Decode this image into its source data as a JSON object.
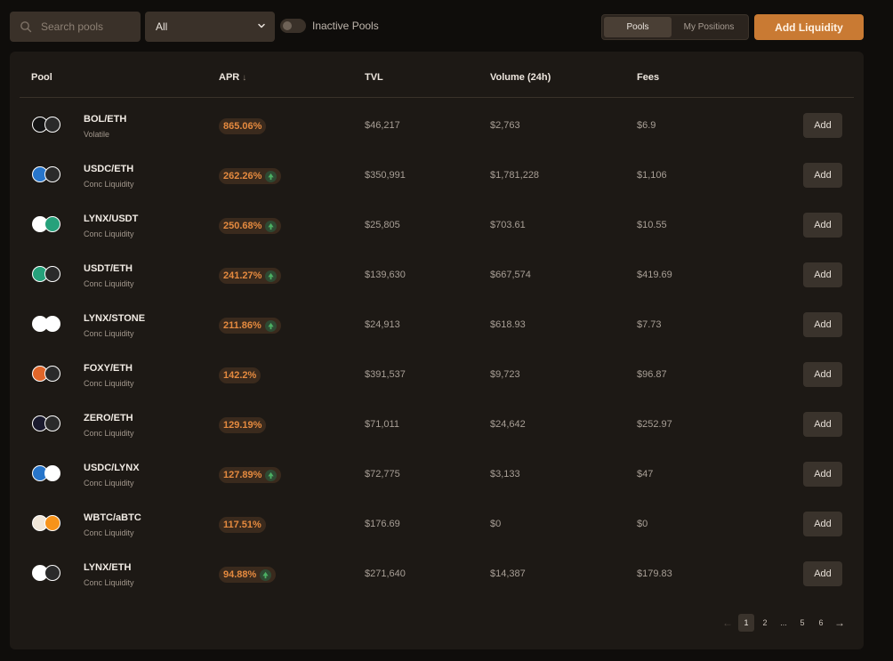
{
  "search": {
    "placeholder": "Search pools"
  },
  "filter": {
    "selected": "All"
  },
  "inactive_toggle": {
    "label": "Inactive Pools"
  },
  "view_tabs": [
    {
      "label": "Pools"
    },
    {
      "label": "My Positions"
    }
  ],
  "add_liquidity": {
    "label": "Add Liquidity"
  },
  "columns": {
    "pool": "Pool",
    "apr": "APR",
    "tvl": "TVL",
    "volume": "Volume (24h)",
    "fees": "Fees"
  },
  "rows": [
    {
      "pair": "BOL/ETH",
      "type": "Volatile",
      "apr": "865.06%",
      "boost": false,
      "tvl": "$46,217",
      "volume": "$2,763",
      "fees": "$6.9",
      "add": "Add"
    },
    {
      "pair": "USDC/ETH",
      "type": "Conc Liquidity",
      "apr": "262.26%",
      "boost": true,
      "tvl": "$350,991",
      "volume": "$1,781,228",
      "fees": "$1,106",
      "add": "Add"
    },
    {
      "pair": "LYNX/USDT",
      "type": "Conc Liquidity",
      "apr": "250.68%",
      "boost": true,
      "tvl": "$25,805",
      "volume": "$703.61",
      "fees": "$10.55",
      "add": "Add"
    },
    {
      "pair": "USDT/ETH",
      "type": "Conc Liquidity",
      "apr": "241.27%",
      "boost": true,
      "tvl": "$139,630",
      "volume": "$667,574",
      "fees": "$419.69",
      "add": "Add"
    },
    {
      "pair": "LYNX/STONE",
      "type": "Conc Liquidity",
      "apr": "211.86%",
      "boost": true,
      "tvl": "$24,913",
      "volume": "$618.93",
      "fees": "$7.73",
      "add": "Add"
    },
    {
      "pair": "FOXY/ETH",
      "type": "Conc Liquidity",
      "apr": "142.2%",
      "boost": false,
      "tvl": "$391,537",
      "volume": "$9,723",
      "fees": "$96.87",
      "add": "Add"
    },
    {
      "pair": "ZERO/ETH",
      "type": "Conc Liquidity",
      "apr": "129.19%",
      "boost": false,
      "tvl": "$71,011",
      "volume": "$24,642",
      "fees": "$252.97",
      "add": "Add"
    },
    {
      "pair": "USDC/LYNX",
      "type": "Conc Liquidity",
      "apr": "127.89%",
      "boost": true,
      "tvl": "$72,775",
      "volume": "$3,133",
      "fees": "$47",
      "add": "Add"
    },
    {
      "pair": "WBTC/aBTC",
      "type": "Conc Liquidity",
      "apr": "117.51%",
      "boost": false,
      "tvl": "$176.69",
      "volume": "$0",
      "fees": "$0",
      "add": "Add"
    },
    {
      "pair": "LYNX/ETH",
      "type": "Conc Liquidity",
      "apr": "94.88%",
      "boost": true,
      "tvl": "$271,640",
      "volume": "$14,387",
      "fees": "$179.83",
      "add": "Add"
    }
  ],
  "pagination": {
    "pages": [
      "1",
      "2",
      "...",
      "5",
      "6"
    ],
    "current": "1"
  },
  "token_colors": {
    "BOL": "#141414",
    "ETH": "#2a2a2a",
    "USDC": "#2775ca",
    "LYNX": "#ffffff",
    "USDT": "#26a17b",
    "STONE": "#ffffff",
    "FOXY": "#e0662a",
    "ZERO": "#1a1a2e",
    "WBTC": "#f0e6d8",
    "aBTC": "#f7931a"
  },
  "accent_color": "#c97a33",
  "apr_text_color": "#e58a3f"
}
